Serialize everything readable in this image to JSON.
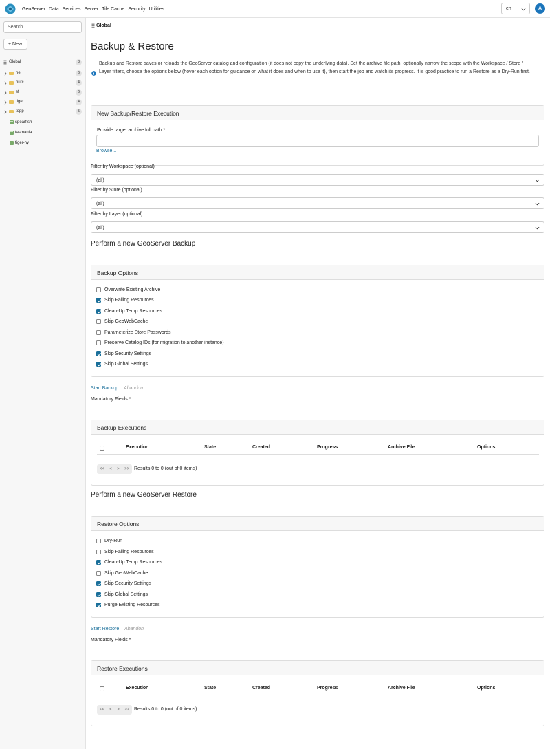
{
  "topnav": [
    "GeoServer",
    "Data",
    "Services",
    "Server",
    "Tile Cache",
    "Security",
    "Utilities"
  ],
  "lang": "en",
  "avatar": "A",
  "sidebar": {
    "search_placeholder": "Search...",
    "new_label": "+ New",
    "global": {
      "label": "Global",
      "count": "8"
    },
    "workspaces": [
      {
        "label": "ne",
        "count": "6"
      },
      {
        "label": "nurc",
        "count": "4"
      },
      {
        "label": "sf",
        "count": "6"
      },
      {
        "label": "tiger",
        "count": "4"
      },
      {
        "label": "topp",
        "count": "5"
      }
    ],
    "groups": [
      "spearfish",
      "tasmania",
      "tiger-ny"
    ]
  },
  "breadcrumb": "Global",
  "page": {
    "title": "Backup & Restore",
    "description": "Backup and Restore saves or reloads the GeoServer catalog and configuration (it does not copy the underlying data). Set the archive file path, optionally narrow the scope with the Workspace / Store / Layer filters, choose the options below (hover each option for guidance on what it does and when to use it), then start the job and watch its progress. It is good practice to run a Restore as a Dry-Run first."
  },
  "execution": {
    "panel_title": "New Backup/Restore Execution",
    "archive_label": "Provide target archive full path *",
    "browse": "Browse...",
    "workspace_label": "Filter by Workspace (optional)",
    "workspace_value": "(all)",
    "store_label": "Filter by Store (optional)",
    "store_value": "(all)",
    "layer_label": "Filter by Layer (optional)",
    "layer_value": "(all)"
  },
  "backup": {
    "section_title": "Perform a new GeoServer Backup",
    "options_title": "Backup Options",
    "options": [
      {
        "label": "Overwrite Existing Archive",
        "checked": false
      },
      {
        "label": "Skip Failing Resources",
        "checked": true
      },
      {
        "label": "Clean-Up Temp Resources",
        "checked": true
      },
      {
        "label": "Skip GeoWebCache",
        "checked": false
      },
      {
        "label": "Parameterize Store Passwords",
        "checked": false
      },
      {
        "label": "Preserve Catalog IDs (for migration to another instance)",
        "checked": false
      },
      {
        "label": "Skip Security Settings",
        "checked": true
      },
      {
        "label": "Skip Global Settings",
        "checked": true
      }
    ],
    "start": "Start Backup",
    "abandon": "Abandon",
    "mandatory": "Mandatory Fields *",
    "executions_title": "Backup Executions",
    "results": "Results 0 to 0 (out of 0 items)"
  },
  "restore": {
    "section_title": "Perform a new GeoServer Restore",
    "options_title": "Restore Options",
    "options": [
      {
        "label": "Dry-Run",
        "checked": false
      },
      {
        "label": "Skip Failing Resources",
        "checked": false
      },
      {
        "label": "Clean-Up Temp Resources",
        "checked": true
      },
      {
        "label": "Skip GeoWebCache",
        "checked": false
      },
      {
        "label": "Skip Security Settings",
        "checked": true
      },
      {
        "label": "Skip Global Settings",
        "checked": true
      },
      {
        "label": "Purge Existing Resources",
        "checked": true
      }
    ],
    "start": "Start Restore",
    "abandon": "Abandon",
    "mandatory": "Mandatory Fields *",
    "executions_title": "Restore Executions",
    "results": "Results 0 to 0 (out of 0 items)"
  },
  "table_headers": [
    "Execution",
    "State",
    "Created",
    "Progress",
    "Archive File",
    "Options"
  ],
  "pager": [
    "<<",
    "<",
    ">",
    ">>"
  ],
  "colors": {
    "accent": "#1a6f9a",
    "avatar": "#1b75bb",
    "folder": "#e8c25a"
  }
}
